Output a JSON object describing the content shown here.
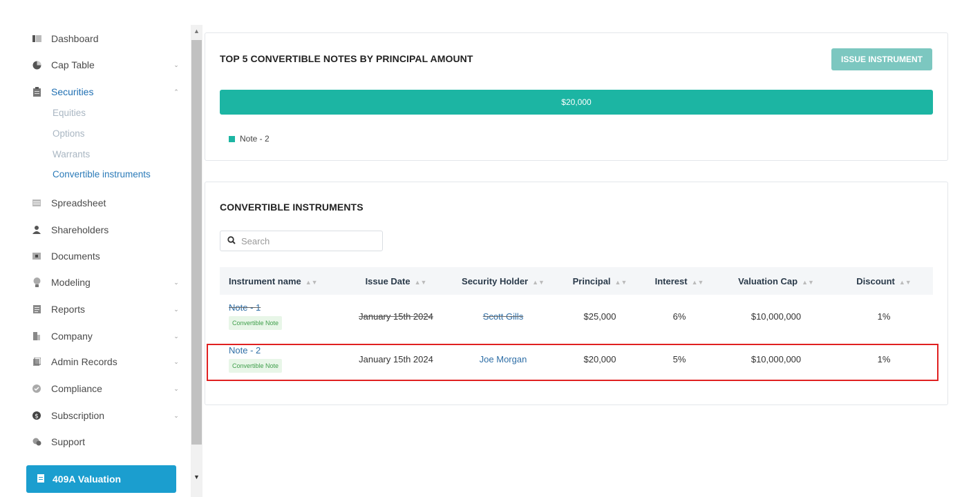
{
  "sidebar": {
    "items": [
      {
        "label": "Dashboard",
        "icon": "dashboard-icon",
        "chevron": ""
      },
      {
        "label": "Cap Table",
        "icon": "pie-chart-icon",
        "chevron": "⌄"
      },
      {
        "label": "Securities",
        "icon": "clipboard-icon",
        "chevron": "⌃"
      },
      {
        "label": "Spreadsheet",
        "icon": "spreadsheet-icon",
        "chevron": ""
      },
      {
        "label": "Shareholders",
        "icon": "user-icon",
        "chevron": ""
      },
      {
        "label": "Documents",
        "icon": "folder-icon",
        "chevron": ""
      },
      {
        "label": "Modeling",
        "icon": "lightbulb-icon",
        "chevron": "⌄"
      },
      {
        "label": "Reports",
        "icon": "report-icon",
        "chevron": "⌄"
      },
      {
        "label": "Company",
        "icon": "building-icon",
        "chevron": "⌄"
      },
      {
        "label": "Admin Records",
        "icon": "admin-icon",
        "chevron": "⌄"
      },
      {
        "label": "Compliance",
        "icon": "shield-check-icon",
        "chevron": "⌄"
      },
      {
        "label": "Subscription",
        "icon": "dollar-icon",
        "chevron": "⌄"
      },
      {
        "label": "Support",
        "icon": "support-icon",
        "chevron": ""
      }
    ],
    "securities_sub": [
      "Equities",
      "Options",
      "Warrants",
      "Convertible instruments"
    ],
    "valuation_button": "409A Valuation"
  },
  "chart_card": {
    "title": "TOP 5 CONVERTIBLE NOTES BY PRINCIPAL AMOUNT",
    "issue_button": "ISSUE INSTRUMENT"
  },
  "chart_data": {
    "type": "bar",
    "categories": [
      "Note - 2"
    ],
    "values": [
      20000
    ],
    "value_labels": [
      "$20,000"
    ],
    "legend": [
      "Note - 2"
    ],
    "colors": {
      "bar": "#1cb5a3"
    }
  },
  "instruments": {
    "title": "CONVERTIBLE INSTRUMENTS",
    "search_placeholder": "Search",
    "columns": [
      "Instrument name",
      "Issue Date",
      "Security Holder",
      "Principal",
      "Interest",
      "Valuation Cap",
      "Discount"
    ],
    "rows": [
      {
        "name": "Note - 1",
        "type": "Convertible Note",
        "date": "January 15th 2024",
        "holder": "Scott Gills",
        "principal": "$25,000",
        "interest": "6%",
        "cap": "$10,000,000",
        "discount": "1%"
      },
      {
        "name": "Note - 2",
        "type": "Convertible Note",
        "date": "January 15th 2024",
        "holder": "Joe Morgan",
        "principal": "$20,000",
        "interest": "5%",
        "cap": "$10,000,000",
        "discount": "1%"
      }
    ]
  },
  "colors": {
    "accent": "#1cb5a3",
    "link": "#2e6ea6",
    "valuation": "#1b9ecf",
    "highlight": "#e02020"
  }
}
